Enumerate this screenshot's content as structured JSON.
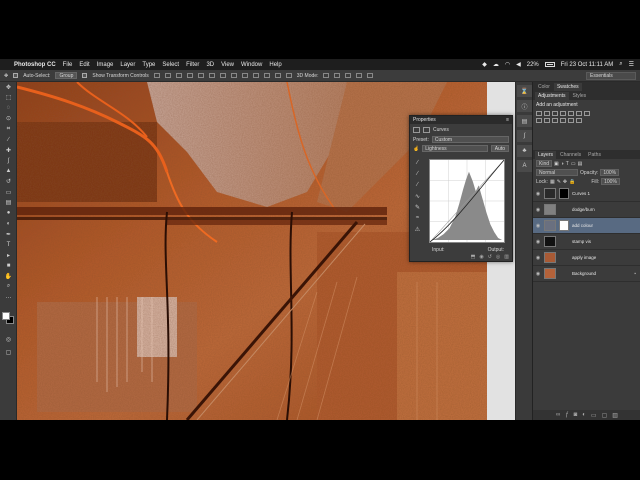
{
  "menubar": {
    "app_name": "Photoshop CC",
    "items": [
      "File",
      "Edit",
      "Image",
      "Layer",
      "Type",
      "Select",
      "Filter",
      "3D",
      "View",
      "Window",
      "Help"
    ],
    "battery": "22%",
    "datetime": "Fri 23 Oct  11:11 AM"
  },
  "options": {
    "auto_select_label": "Auto-Select:",
    "auto_select_value": "Group",
    "show_transform_label": "Show Transform Controls",
    "mode_3d": "3D Mode:",
    "workspace": "Essentials"
  },
  "toolbox": {
    "tools": [
      "move",
      "marquee",
      "lasso",
      "quick-select",
      "crop",
      "eyedropper",
      "healing",
      "brush",
      "stamp",
      "history-brush",
      "eraser",
      "gradient",
      "blur",
      "dodge",
      "pen",
      "type",
      "path-select",
      "shape",
      "hand",
      "zoom",
      "more"
    ]
  },
  "properties": {
    "title": "Properties",
    "panel_name": "Curves",
    "preset_label": "Preset:",
    "preset_value": "Custom",
    "channel_value": "Lightness",
    "auto_label": "Auto",
    "input_label": "Input:",
    "output_label": "Output:"
  },
  "panels": {
    "top_tabs": [
      "Color",
      "Swatches"
    ],
    "adj_tabs": [
      "Adjustments",
      "Styles"
    ],
    "add_adjustment": "Add an adjustment",
    "layer_tabs": [
      "Layers",
      "Channels",
      "Paths"
    ],
    "kind_label": "Kind",
    "blend_mode": "Normal",
    "opacity_label": "Opacity:",
    "opacity_value": "100%",
    "lock_label": "Lock:",
    "fill_label": "Fill:",
    "fill_value": "100%",
    "layers": [
      {
        "name": "Curves 1",
        "selected": false,
        "thumb": "#2a2a2a",
        "mask": "#000"
      },
      {
        "name": "dodge/burn",
        "selected": false,
        "thumb": "#808080",
        "mask": null
      },
      {
        "name": "add colour",
        "selected": true,
        "thumb": "#6a7080",
        "mask": "#fff"
      },
      {
        "name": "stamp vis",
        "selected": false,
        "thumb": "#111",
        "mask": null
      },
      {
        "name": "apply image",
        "selected": false,
        "thumb": "#a85a35",
        "mask": null
      },
      {
        "name": "Background",
        "selected": false,
        "thumb": "#b4623a",
        "mask": null
      }
    ]
  }
}
